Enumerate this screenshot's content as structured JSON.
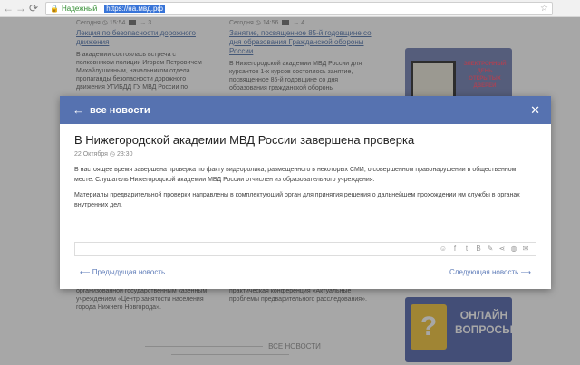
{
  "browser": {
    "secure_label": "Надежный",
    "url": "https://на.мвд.рф"
  },
  "background": {
    "col1": {
      "meta_date": "Сегодня",
      "meta_time": "15:54",
      "meta_views": "3",
      "title": "Лекция по безопасности дорожного движения",
      "text": "В академии состоялась встреча с полковником полиции Игорем Петровичем Михайлушкиным, начальником отдела пропаганды безопасности дорожного движения УГИБДД ГУ МВД России по",
      "bottom_text": "занятых в различных профессиях, организованной государственным казенным учреждением «Центр занятости населения города Нижнего Новгорода»."
    },
    "col2": {
      "meta_date": "Сегодня",
      "meta_time": "14:56",
      "meta_views": "4",
      "title": "Занятие, посвященное 85-й годовщине со дня образования Гражданской обороны России",
      "text": "В Нижегородской академии МВД России для курсантов 1-х курсов состоялось занятие, посвященное 85-й годовщине со дня образования гражданской обороны",
      "bottom_text": "расследования провела всероссийская научно-практическая конференция «Актуальные проблемы предварительного расследования»."
    },
    "banner1_text": "ЭЛЕКТРОННЫЙ ДЕНЬ ОТКРЫТЫХ ДВЕРЕЙ",
    "banner2_text": "ОНЛАЙН ВОПРОСЫ",
    "all_news": "ВСЕ НОВОСТИ"
  },
  "modal": {
    "back_label": "все новости",
    "title": "В Нижегородской академии МВД России завершена проверка",
    "date": "22 Октября",
    "time": "23:30",
    "paragraph1": "В настоящее время завершена проверка по факту видеоролика, размещенного в некоторых СМИ, о совершенном правонарушении в общественном месте. Слушатель Нижегородской академии МВД России отчислен из образовательного учреждения.",
    "paragraph2": "Материалы предварительной проверки направлены в комплектующий орган  для принятия решения о дальнейшем прохождении им службы в органах внутренних дел.",
    "prev_label": "Предыдущая новость",
    "next_label": "Следующая новость",
    "share_icons": [
      "odnoklassniki-icon",
      "facebook-icon",
      "twitter-icon",
      "vk-icon",
      "livejournal-icon",
      "share-icon",
      "blog-icon",
      "mail-icon"
    ]
  },
  "colors": {
    "header_bg": "#5672b0",
    "link": "#5d7bb8"
  }
}
